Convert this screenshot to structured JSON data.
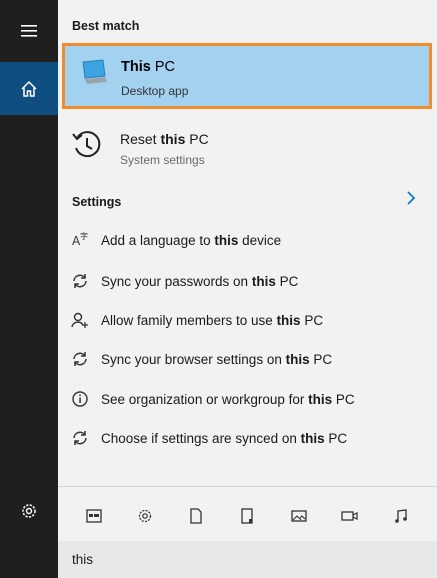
{
  "rail": {
    "menu_icon": "hamburger-icon",
    "home_icon": "home-icon",
    "settings_icon": "gear-icon"
  },
  "best_match": {
    "title": "Best match",
    "item": {
      "title_plain": "This",
      "title_rest": " PC",
      "subtitle": "Desktop app",
      "icon": "computer-icon"
    }
  },
  "other": {
    "title_plain": "Reset ",
    "title_bold": "this",
    "title_rest": " PC",
    "subtitle": "System settings",
    "icon": "history-icon"
  },
  "settings": {
    "title": "Settings",
    "items": [
      {
        "pre": "Add a language to ",
        "bold": "this",
        "post": " device",
        "icon": "language-icon"
      },
      {
        "pre": "Sync your passwords on ",
        "bold": "this",
        "post": " PC",
        "icon": "sync-icon"
      },
      {
        "pre": "Allow family members to use ",
        "bold": "this",
        "post": " PC",
        "icon": "person-add-icon"
      },
      {
        "pre": "Sync your browser settings on ",
        "bold": "this",
        "post": " PC",
        "icon": "sync-icon"
      },
      {
        "pre": "See organization or workgroup for ",
        "bold": "this",
        "post": " PC",
        "icon": "info-icon"
      },
      {
        "pre": "Choose if settings are synced on ",
        "bold": "this",
        "post": " PC",
        "icon": "sync-icon"
      }
    ]
  },
  "filters": [
    "apps-icon",
    "settings-icon",
    "documents-icon",
    "folders-icon",
    "photos-icon",
    "videos-icon",
    "music-icon"
  ],
  "search": {
    "value": "this"
  }
}
